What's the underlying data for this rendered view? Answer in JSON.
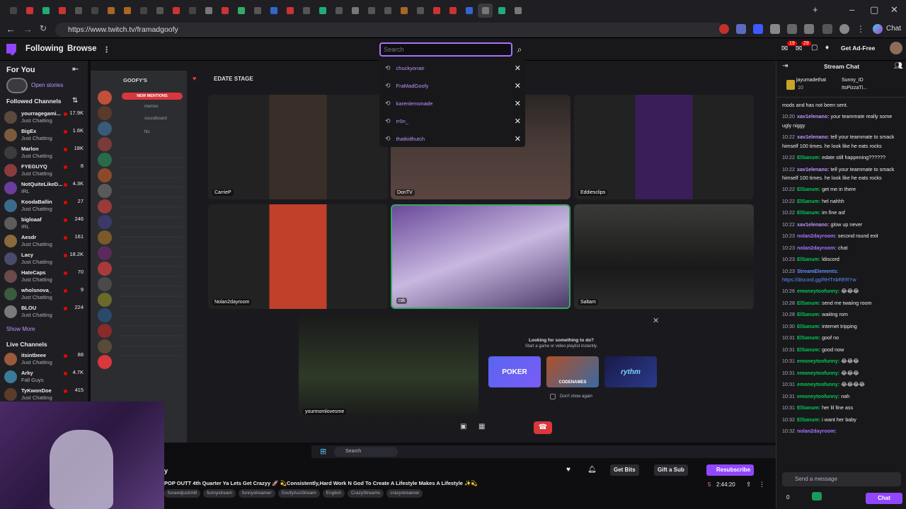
{
  "browser": {
    "url": "https://www.twitch.tv/framadgoofy",
    "chat_btn": "Chat"
  },
  "colors": {
    "accent": "#9147ff",
    "live": "#eb0400",
    "bg": "#0e0e10"
  },
  "nav": {
    "following": "Following",
    "browse": "Browse",
    "search_placeholder": "Search",
    "get_ad_free": "Get Ad-Free",
    "notif_badge": "19",
    "whisper_badge": "29"
  },
  "search_history": [
    {
      "name": "chuckyonair"
    },
    {
      "name": "FraMadGoofy"
    },
    {
      "name": "karenlemonade"
    },
    {
      "name": "rr0n_"
    },
    {
      "name": "thatkidhutch"
    }
  ],
  "sidebar": {
    "for_you": "For You",
    "open_stories": "Open stories",
    "followed_title": "Followed Channels",
    "followed": [
      {
        "name": "yourragegami...",
        "cat": "Just Chatting",
        "count": "17.9K",
        "color": "#5a4a3c"
      },
      {
        "name": "BigEx",
        "cat": "Just Chatting",
        "count": "1.6K",
        "color": "#7a5c3c"
      },
      {
        "name": "Marlon",
        "cat": "Just Chatting",
        "count": "18K",
        "color": "#3c3c3c"
      },
      {
        "name": "FYEGUYQ",
        "cat": "Just Chatting",
        "count": "8",
        "color": "#8a3c3c"
      },
      {
        "name": "NotQuiteLikeD...",
        "cat": "IRL",
        "count": "4.3K",
        "color": "#6a3c9c"
      },
      {
        "name": "KoodaBallin",
        "cat": "Just Chatting",
        "count": "27",
        "color": "#3c6a8a"
      },
      {
        "name": "bigloaaf",
        "cat": "IRL",
        "count": "246",
        "color": "#5c5c5c"
      },
      {
        "name": "Aesdr",
        "cat": "Just Chatting",
        "count": "161",
        "color": "#8a6a3c"
      },
      {
        "name": "Lacy",
        "cat": "Just Chatting",
        "count": "18.2K",
        "color": "#4a4a6a"
      },
      {
        "name": "HateCaps",
        "cat": "Just Chatting",
        "count": "70",
        "color": "#6a4a4a"
      },
      {
        "name": "wholsnova_",
        "cat": "Just Chatting",
        "count": "9",
        "color": "#3c5a3c"
      },
      {
        "name": "BLOU",
        "cat": "Just Chatting",
        "count": "224",
        "color": "#7a7a7a"
      }
    ],
    "show_more": "Show More",
    "live_title": "Live Channels",
    "live": [
      {
        "name": "itsintbeee",
        "cat": "Just Chatting",
        "count": "88",
        "color": "#9a5a3c"
      },
      {
        "name": "Arky",
        "cat": "Fall Guys",
        "count": "4.7K",
        "color": "#3c7a9a"
      },
      {
        "name": "TyKwonDoe",
        "cat": "Just Chatting",
        "count": "415",
        "color": "#5a3c2a"
      }
    ]
  },
  "discord": {
    "server": "GOOFY'S",
    "stage": "EDATE STAGE",
    "new_mentions": "NEW MENTIONS",
    "channels": [
      "memes",
      "soundboard",
      "fits"
    ],
    "tiles": [
      {
        "name": "CarrieP"
      },
      {
        "name": "DonTV"
      },
      {
        "name": "Eddiesclips"
      },
      {
        "name": "Nolan2dayroom"
      },
      {
        "name": "rsk"
      },
      {
        "name": "Saltam"
      },
      {
        "name": "yourmomlovesme"
      }
    ],
    "looking_title": "Looking for something to do?",
    "looking_sub": "Start a game or video playlist instantly.",
    "dont_show": "Don't show again",
    "cards": [
      "POKER",
      "CODENAMES",
      "rythm"
    ],
    "taskbar_search": "Search"
  },
  "stream": {
    "title": "POP OUTT 4th Quarter Ya Lets Get Crazyy 🚀 💫Consistently,Hard Work N God To Create A Lifestyle Makes A Lifestyle ✨💫",
    "tags": [
      "funandjustchill",
      "funnystream",
      "funnystreamer",
      "GoofyAssStream",
      "English",
      "CrazyStreams",
      "crazystreamer"
    ],
    "viewers": "5",
    "uptime": "2:44:20",
    "get_bits": "Get Bits",
    "gift_sub": "Gift a Sub",
    "resubscribe": "Resubscribe",
    "name_fragment": "y"
  },
  "chat": {
    "title": "Stream Chat",
    "gifters": [
      {
        "name": "jayumadethat",
        "count": "10"
      },
      {
        "name": "Sunny_ID",
        "count": ""
      },
      {
        "name": "ItsPizzaTi...",
        "count": ""
      }
    ],
    "messages": [
      {
        "time": "",
        "user": "",
        "text": "mods and has not been sent.",
        "color": "#efeff1"
      },
      {
        "time": "10:20",
        "user": "xav1elenano:",
        "text": "your teammate really some ugly niggy",
        "color": "#bf94ff"
      },
      {
        "time": "10:22",
        "user": "xav1elenano:",
        "text": "tell your teammate to smack himself 100 times. he look like he eats rocks",
        "color": "#bf94ff"
      },
      {
        "time": "10:22",
        "user": "ElSanum:",
        "text": "edate still happening??????",
        "color": "#00c853"
      },
      {
        "time": "10:22",
        "user": "xav1elenano:",
        "text": "tell your teammate to smack himself 100 times. he look like he eats rocks",
        "color": "#bf94ff"
      },
      {
        "time": "10:22",
        "user": "ElSanum:",
        "text": "get me in there",
        "color": "#00c853"
      },
      {
        "time": "10:22",
        "user": "ElSanum:",
        "text": "hel nahhh",
        "color": "#00c853"
      },
      {
        "time": "10:22",
        "user": "ElSanum:",
        "text": "im fine asf",
        "color": "#00c853"
      },
      {
        "time": "10:22",
        "user": "xav1elenano:",
        "text": "glow up never",
        "color": "#bf94ff"
      },
      {
        "time": "10:23",
        "user": "nolan2dayroom:",
        "text": "second round exit",
        "color": "#a970ff"
      },
      {
        "time": "10:23",
        "user": "nolan2dayroom:",
        "text": "chat",
        "color": "#a970ff"
      },
      {
        "time": "10:23",
        "user": "ElSanum:",
        "text": "ldiscord",
        "color": "#00c853"
      },
      {
        "time": "10:23",
        "user": "StreamElements:",
        "text": "https://discord.gg/RHTnbRERYw",
        "color": "#5c8fff"
      },
      {
        "time": "10:26",
        "user": "emoneytoofunny:",
        "text": "😂😂😂",
        "color": "#00c853"
      },
      {
        "time": "10:28",
        "user": "ElSanum:",
        "text": "send me twaiing room",
        "color": "#00c853"
      },
      {
        "time": "10:28",
        "user": "ElSanum:",
        "text": "waiitng rom",
        "color": "#00c853"
      },
      {
        "time": "10:30",
        "user": "ElSanum:",
        "text": "internet tripping",
        "color": "#00c853"
      },
      {
        "time": "10:31",
        "user": "ElSanum:",
        "text": "goof no",
        "color": "#00c853"
      },
      {
        "time": "10:31",
        "user": "ElSanum:",
        "text": "good now",
        "color": "#00c853"
      },
      {
        "time": "10:31",
        "user": "emoneytoofunny:",
        "text": "😂😂😂",
        "color": "#00c853"
      },
      {
        "time": "10:31",
        "user": "emoneytoofunny:",
        "text": "😂😂😂",
        "color": "#00c853"
      },
      {
        "time": "10:31",
        "user": "emoneytoofunny:",
        "text": "😂😂😂😂",
        "color": "#00c853"
      },
      {
        "time": "10:31",
        "user": "emoneytoofunny:",
        "text": "nah",
        "color": "#00c853"
      },
      {
        "time": "10:31",
        "user": "ElSanum:",
        "text": "her lil fine ass",
        "color": "#00c853"
      },
      {
        "time": "10:32",
        "user": "ElSanum:",
        "text": "i want her baby",
        "color": "#00c853"
      },
      {
        "time": "10:32",
        "user": "nolan2dayroom:",
        "text": "",
        "color": "#a970ff"
      }
    ],
    "input_placeholder": "Send a message",
    "points": "0",
    "chat_button": "Chat"
  }
}
